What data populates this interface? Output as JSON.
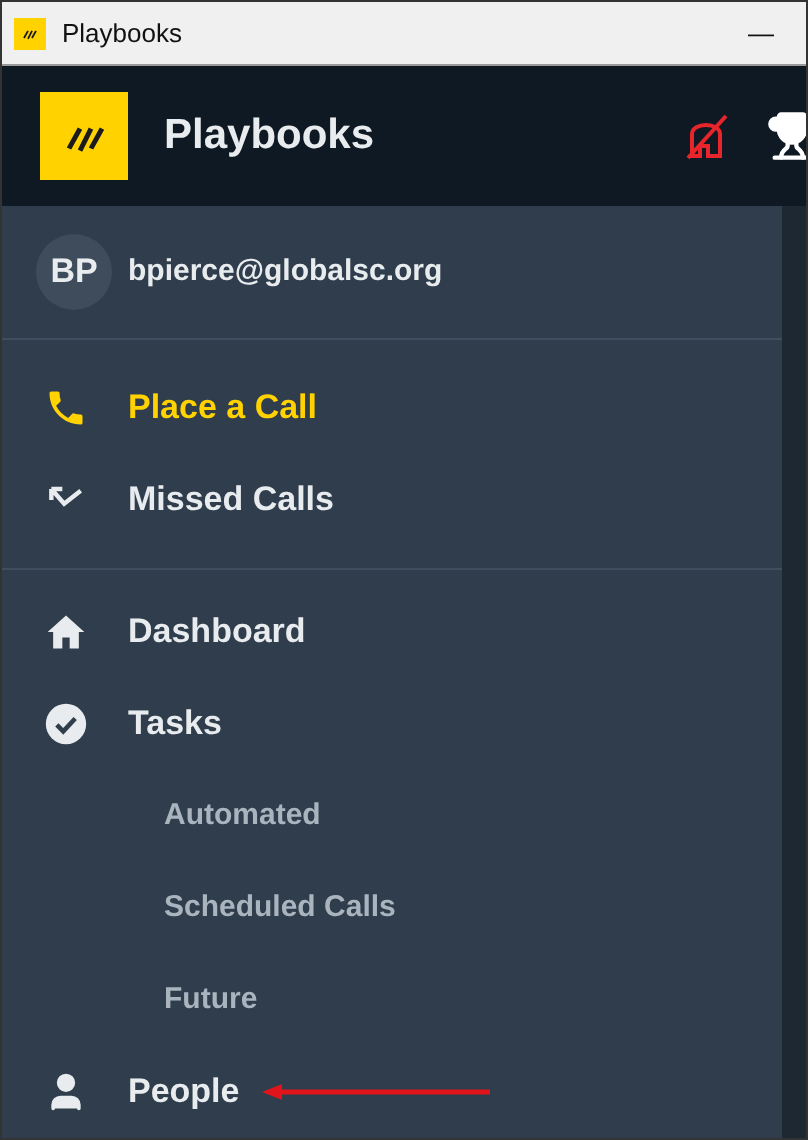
{
  "window": {
    "title": "Playbooks",
    "minimize": "—"
  },
  "header": {
    "title": "Playbooks"
  },
  "user": {
    "initials": "BP",
    "email": "bpierce@globalsc.org"
  },
  "call_nav": [
    {
      "label": "Place a Call",
      "selected": true
    },
    {
      "label": "Missed Calls",
      "selected": false
    }
  ],
  "main_nav": [
    {
      "label": "Dashboard",
      "kind": "item"
    },
    {
      "label": "Tasks",
      "kind": "item"
    },
    {
      "label": "Automated",
      "kind": "sub"
    },
    {
      "label": "Scheduled Calls",
      "kind": "sub"
    },
    {
      "label": "Future",
      "kind": "sub"
    },
    {
      "label": "People",
      "kind": "item",
      "annotated": true
    }
  ]
}
